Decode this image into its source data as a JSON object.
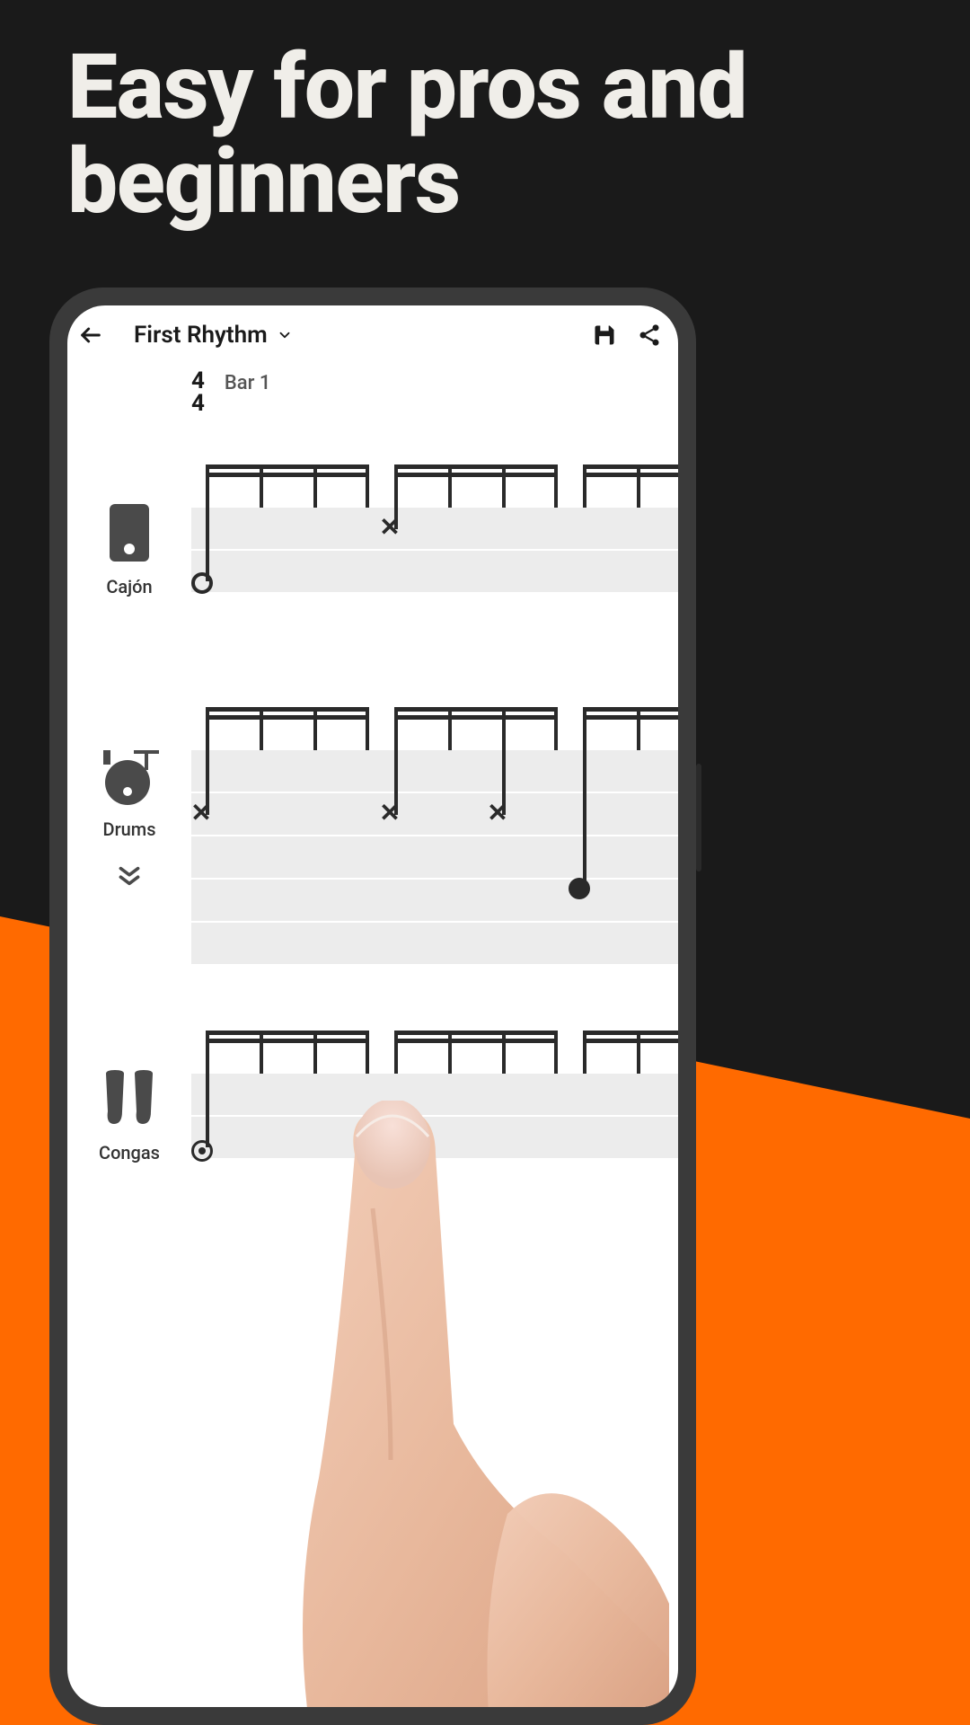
{
  "headline": "Easy for pros and beginners",
  "app": {
    "title": "First Rhythm",
    "bar_label": "Bar 1",
    "time_sig_top": "4",
    "time_sig_bottom": "4",
    "instruments": {
      "cajon": "Cajón",
      "drums": "Drums",
      "congas": "Congas"
    }
  },
  "colors": {
    "accent": "#ff6a00",
    "dark": "#1a1a1a"
  }
}
